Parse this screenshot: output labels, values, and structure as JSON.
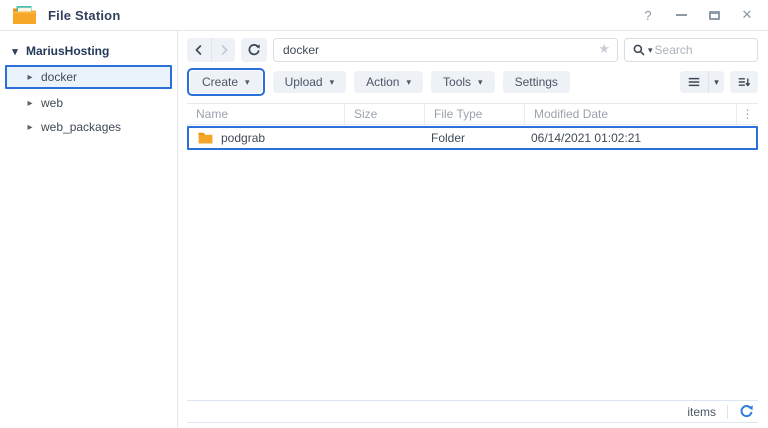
{
  "window": {
    "title": "File Station",
    "controls": {
      "help": "?",
      "close": "✕"
    }
  },
  "icons": {
    "caret_down": "▾",
    "caret_right": "▸",
    "star": "★",
    "options_dots": "⋮"
  },
  "sidebar": {
    "root_label": "MariusHosting",
    "items": [
      {
        "label": "docker",
        "selected": true
      },
      {
        "label": "web",
        "selected": false
      },
      {
        "label": "web_packages",
        "selected": false
      }
    ]
  },
  "toolbar": {
    "path_value": "docker",
    "search_placeholder": "Search",
    "buttons": [
      {
        "label": "Create",
        "has_menu": true,
        "highlighted": true
      },
      {
        "label": "Upload",
        "has_menu": true,
        "highlighted": false
      },
      {
        "label": "Action",
        "has_menu": true,
        "highlighted": false
      },
      {
        "label": "Tools",
        "has_menu": true,
        "highlighted": false
      },
      {
        "label": "Settings",
        "has_menu": false,
        "highlighted": false
      }
    ]
  },
  "table": {
    "columns": [
      "Name",
      "Size",
      "File Type",
      "Modified Date"
    ],
    "rows": [
      {
        "name": "podgrab",
        "size": "",
        "file_type": "Folder",
        "modified_date": "06/14/2021 01:02:21",
        "selected": true
      }
    ]
  },
  "statusbar": {
    "items_label": "items"
  },
  "colors": {
    "highlight_blue": "#2b6fd9",
    "folder_orange": "#f4a62a",
    "refresh_blue": "#2f7de1",
    "header_text": "#9aa3ad",
    "title_text": "#33415c",
    "button_bg": "#eef1f5"
  }
}
